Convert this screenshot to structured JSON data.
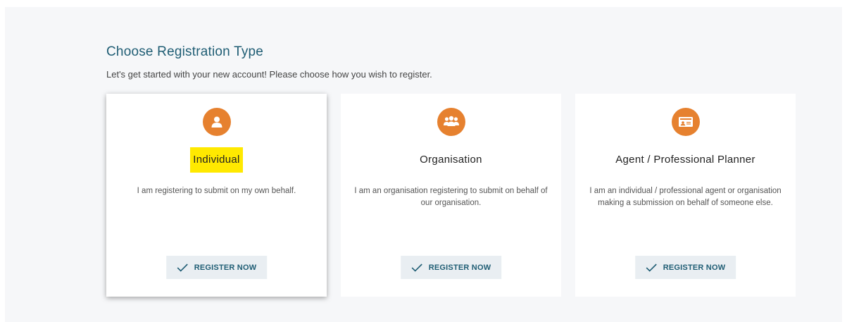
{
  "page": {
    "title": "Choose Registration Type",
    "subtitle": "Let's get started with your new account! Please choose how you wish to register."
  },
  "cards": [
    {
      "icon": "person-icon",
      "name": "Individual",
      "description": "I am registering to submit on my own behalf.",
      "button_label": "REGISTER NOW",
      "selected": true,
      "highlighted": true
    },
    {
      "icon": "group-icon",
      "name": "Organisation",
      "description": "I am an organisation registering to submit on behalf of our organisation.",
      "button_label": "REGISTER NOW",
      "selected": false,
      "highlighted": false
    },
    {
      "icon": "id-card-icon",
      "name": "Agent / Professional Planner",
      "description": "I am an individual / professional agent or organisation making a submission on behalf of someone else.",
      "button_label": "REGISTER NOW",
      "selected": false,
      "highlighted": false
    }
  ],
  "colors": {
    "accent": "#e6812f",
    "heading": "#1f5d74",
    "highlight": "#ffe900",
    "button_bg": "#e9eef2"
  }
}
